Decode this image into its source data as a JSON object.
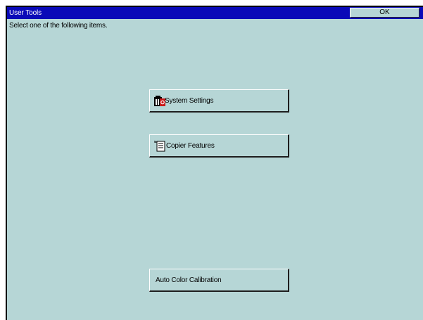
{
  "window": {
    "title": "User Tools",
    "ok_label": "OK"
  },
  "main": {
    "instruction": "Select one of the following items.",
    "items": [
      {
        "label": "System Settings",
        "icon": "system-settings-icon"
      },
      {
        "label": "Copier Features",
        "icon": "copier-features-icon"
      },
      {
        "label": "Auto Color Calibration"
      }
    ]
  },
  "colors": {
    "titlebar": "#0a0ab8",
    "panel": "#b6d6d6",
    "frame": "#000000"
  }
}
